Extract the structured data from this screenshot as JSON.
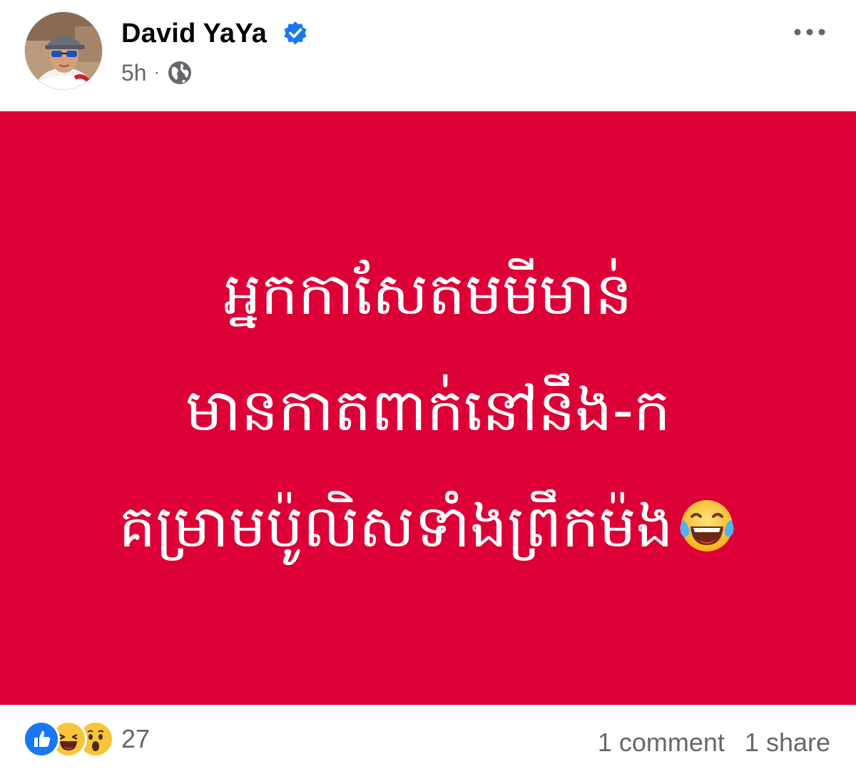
{
  "author": {
    "name": "David YaYa",
    "timestamp": "5h",
    "separator": "·",
    "privacy_icon": "globe-icon",
    "verified_icon": "verified-badge-icon"
  },
  "menu": {
    "icon": "more-options-icon"
  },
  "post": {
    "background_color": "#dc0037",
    "text_color": "#ffffff",
    "lines": [
      "អ្នកកាសែតមមីមាន់",
      "មានកាតពាក់នៅនឹង-ក",
      "គម្រាមប៉ូលិសទាំងព្រឹកម៉ង"
    ],
    "trailing_emoji": "face-with-tears-of-joy-icon"
  },
  "footer": {
    "reactions": [
      "like-icon",
      "laughing-face-icon",
      "surprised-face-icon"
    ],
    "reaction_count": "27",
    "comments": "1 comment",
    "shares": "1 share"
  },
  "colors": {
    "verified_blue": "#1877f2",
    "meta_gray": "#65676b"
  }
}
